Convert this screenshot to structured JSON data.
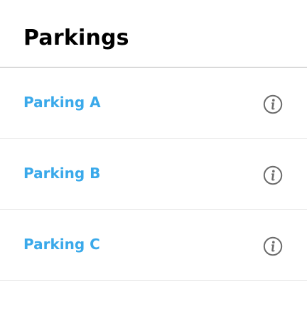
{
  "header": {
    "title": "Parkings"
  },
  "parkings": [
    {
      "label": "Parking A",
      "icon": "info-icon"
    },
    {
      "label": "Parking B",
      "icon": "info-icon"
    },
    {
      "label": "Parking C",
      "icon": "info-icon"
    }
  ],
  "colors": {
    "link": "#3aa9ea",
    "icon": "#6b6b6b",
    "divider": "#e4e4e4"
  }
}
